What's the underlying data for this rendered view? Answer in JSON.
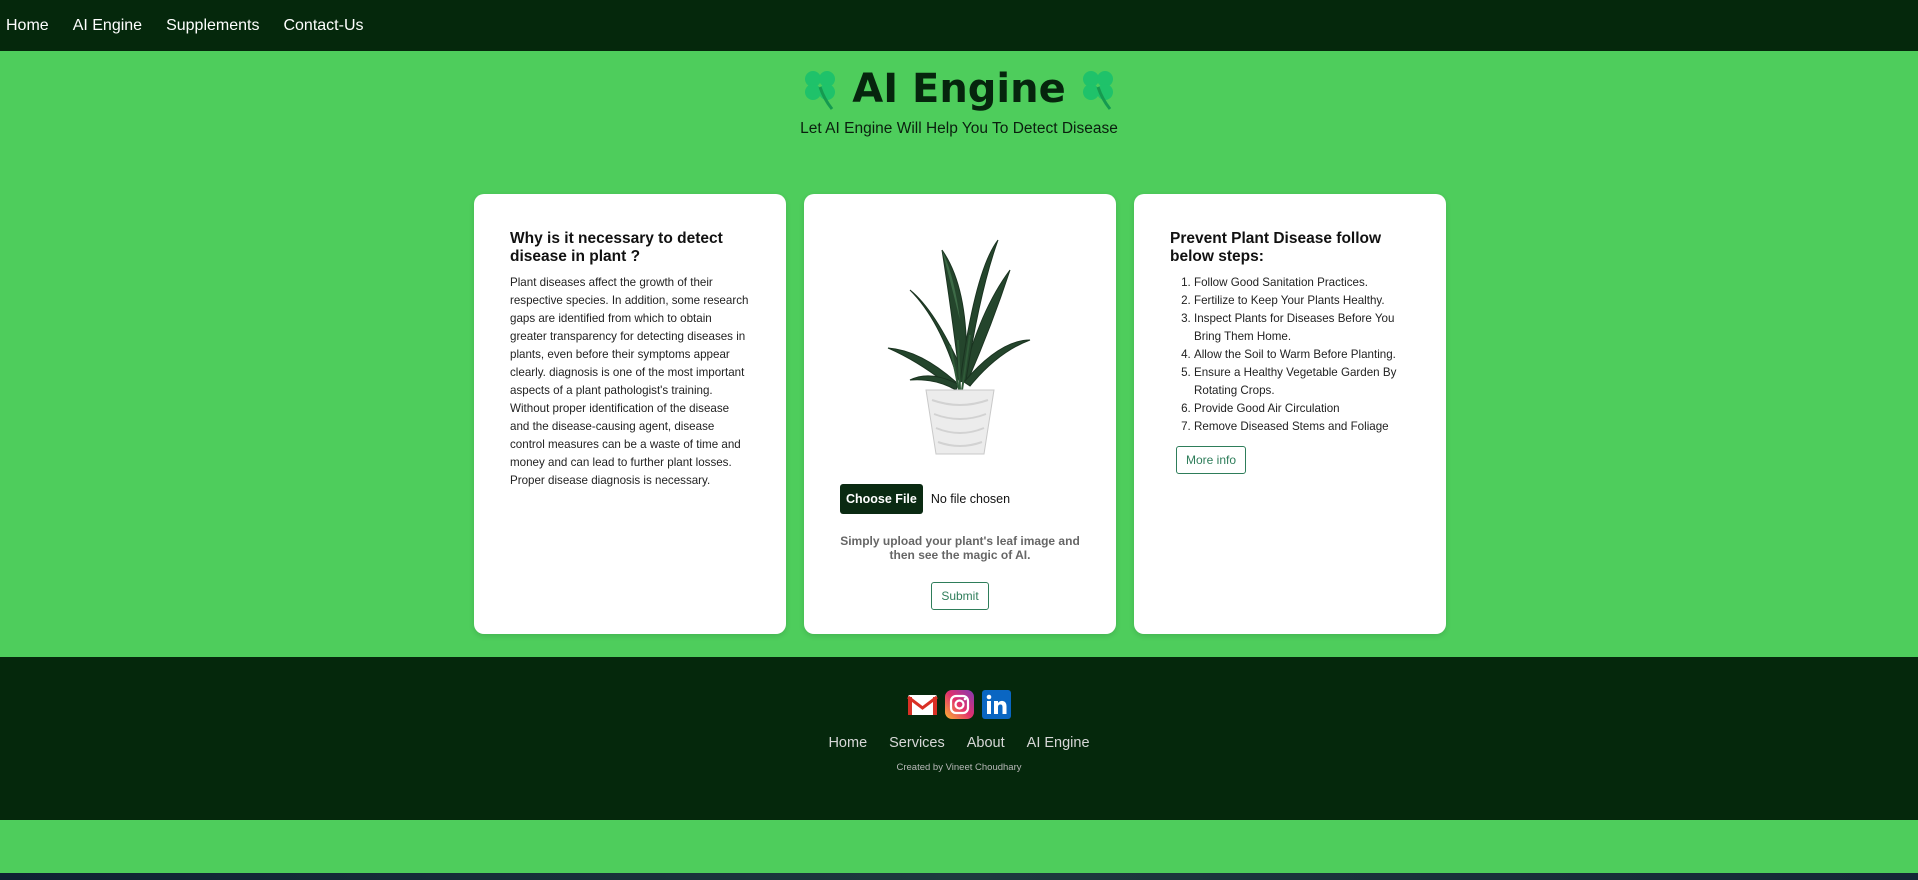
{
  "nav": {
    "items": [
      "Home",
      "AI Engine",
      "Supplements",
      "Contact-Us"
    ]
  },
  "hero": {
    "title": "AI Engine",
    "subtitle": "Let AI Engine Will Help You To Detect Disease",
    "icon": "four-leaf-clover-icon"
  },
  "left_card": {
    "title": "Why is it necessary to detect disease in plant ?",
    "body": "Plant diseases affect the growth of their respective species. In addition, some research gaps are identified from which to obtain greater transparency for detecting diseases in plants, even before their symptoms appear clearly. diagnosis is one of the most important aspects of a plant pathologist's training. Without proper identification of the disease and the disease-causing agent, disease control measures can be a waste of time and money and can lead to further plant losses. Proper disease diagnosis is necessary."
  },
  "upload_card": {
    "choose_file_label": "Choose File",
    "file_status": "No file chosen",
    "hint": "Simply upload your plant's leaf image and then see the magic of AI.",
    "submit_label": "Submit"
  },
  "right_card": {
    "title": "Prevent Plant Disease follow below steps:",
    "steps": [
      "Follow Good Sanitation Practices.",
      "Fertilize to Keep Your Plants Healthy.",
      "Inspect Plants for Diseases Before You Bring Them Home.",
      "Allow the Soil to Warm Before Planting.",
      "Ensure a Healthy Vegetable Garden By Rotating Crops.",
      "Provide Good Air Circulation",
      "Remove Diseased Stems and Foliage"
    ],
    "more_info_label": "More info"
  },
  "footer": {
    "social_icons": [
      "gmail-icon",
      "instagram-icon",
      "linkedin-icon"
    ],
    "links": [
      "Home",
      "Services",
      "About",
      "AI Engine"
    ],
    "credit": "Created by Vineet Choudhary"
  },
  "colors": {
    "page_background": "#4ecd5c",
    "dark_green": "#05280c",
    "accent_outline": "#2e7d5a"
  }
}
